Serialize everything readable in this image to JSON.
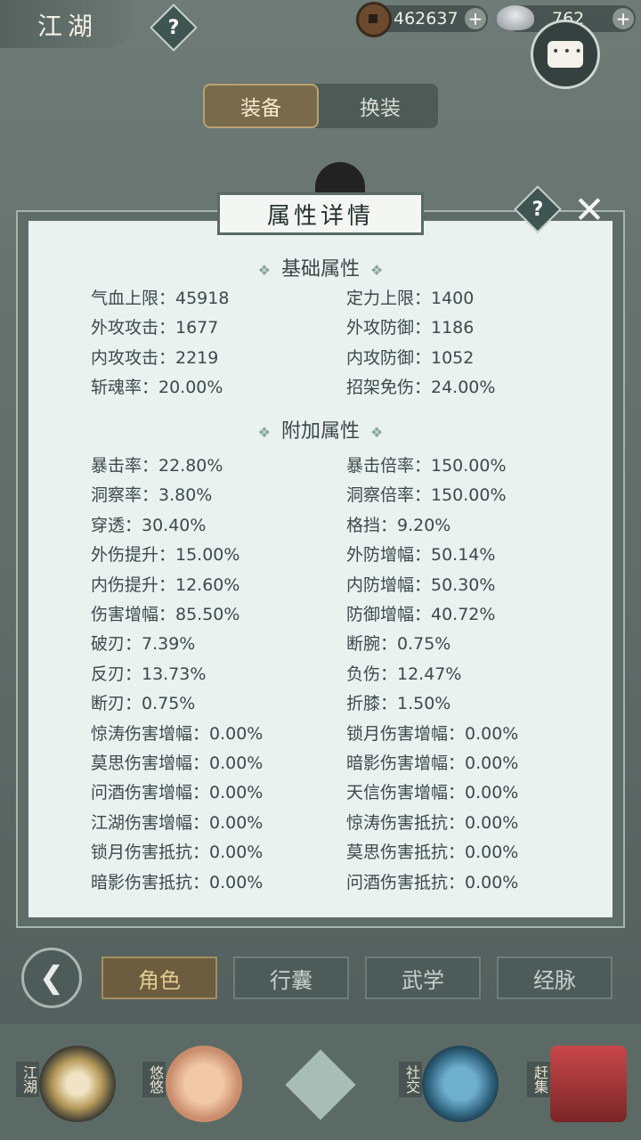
{
  "header": {
    "title": "江湖",
    "help_label": "?",
    "coins": "462637",
    "silver": "762",
    "plus_label": "+"
  },
  "tabs": [
    {
      "label": "装备",
      "active": true
    },
    {
      "label": "换装",
      "active": false
    }
  ],
  "panel": {
    "title": "属性详情",
    "help_label": "?",
    "close_label": "✕",
    "section_base": "基础属性",
    "section_extra": "附加属性",
    "base_stats": [
      [
        "气血上限：45918",
        "定力上限：1400"
      ],
      [
        "外攻攻击：1677",
        "外攻防御：1186"
      ],
      [
        "内攻攻击：2219",
        "内攻防御：1052"
      ],
      [
        "斩魂率：20.00%",
        "招架免伤：24.00%"
      ]
    ],
    "extra_stats": [
      [
        "暴击率：22.80%",
        "暴击倍率：150.00%"
      ],
      [
        "洞察率：3.80%",
        "洞察倍率：150.00%"
      ],
      [
        "穿透：30.40%",
        "格挡：9.20%"
      ],
      [
        "外伤提升：15.00%",
        "外防增幅：50.14%"
      ],
      [
        "内伤提升：12.60%",
        "内防增幅：50.30%"
      ],
      [
        "伤害增幅：85.50%",
        "防御增幅：40.72%"
      ],
      [
        "破刃：7.39%",
        "断腕：0.75%"
      ],
      [
        "反刃：13.73%",
        "负伤：12.47%"
      ],
      [
        "断刃：0.75%",
        "折膝：1.50%"
      ],
      [
        "惊涛伤害增幅：0.00%",
        "锁月伤害增幅：0.00%"
      ],
      [
        "莫思伤害增幅：0.00%",
        "暗影伤害增幅：0.00%"
      ],
      [
        "问酒伤害增幅：0.00%",
        "天信伤害增幅：0.00%"
      ],
      [
        "江湖伤害增幅：0.00%",
        "惊涛伤害抵抗：0.00%"
      ],
      [
        "锁月伤害抵抗：0.00%",
        "莫思伤害抵抗：0.00%"
      ],
      [
        "暗影伤害抵抗：0.00%",
        "问酒伤害抵抗：0.00%"
      ]
    ]
  },
  "nav_tabs": [
    {
      "label": "角色",
      "active": true
    },
    {
      "label": "行囊",
      "active": false
    },
    {
      "label": "武学",
      "active": false
    },
    {
      "label": "经脉",
      "active": false
    }
  ],
  "bottom_nav": [
    {
      "label": "江湖",
      "icon": "straw-hat-icon"
    },
    {
      "label": "悠悠",
      "icon": "swallow-icon"
    },
    {
      "label": "",
      "icon": "compass-star-icon"
    },
    {
      "label": "社交",
      "icon": "wave-icon"
    },
    {
      "label": "赶集",
      "icon": "market-basket-icon"
    }
  ],
  "colors": {
    "panel_bg": "#eaf2ef",
    "accent_gold": "#a38f62",
    "frame": "#5f6d69"
  }
}
